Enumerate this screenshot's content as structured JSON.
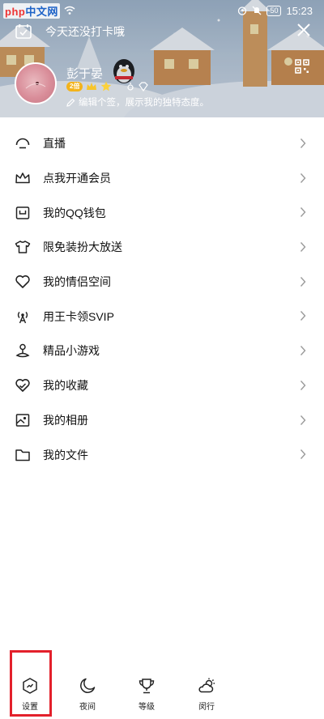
{
  "status_bar": {
    "watermark_red": "php",
    "watermark_blue": "中文网",
    "battery": "50",
    "time": "15:23"
  },
  "header": {
    "checkin_text": "今天还没打卡哦",
    "nickname": "彭于晏",
    "level_badge": "2倍",
    "signature": "编辑个签，展示我的独特态度。"
  },
  "menu": {
    "items": [
      {
        "label": "直播",
        "icon": "live-icon"
      },
      {
        "label": "点我开通会员",
        "icon": "crown-icon"
      },
      {
        "label": "我的QQ钱包",
        "icon": "wallet-icon"
      },
      {
        "label": "限免装扮大放送",
        "icon": "tshirt-icon"
      },
      {
        "label": "我的情侣空间",
        "icon": "heart-icon"
      },
      {
        "label": "用王卡领SVIP",
        "icon": "signal-tower-icon"
      },
      {
        "label": "精品小游戏",
        "icon": "joystick-icon"
      },
      {
        "label": "我的收藏",
        "icon": "heart-check-icon"
      },
      {
        "label": "我的相册",
        "icon": "photo-icon"
      },
      {
        "label": "我的文件",
        "icon": "folder-icon"
      }
    ]
  },
  "bottom_bar": {
    "tabs": [
      {
        "label": "设置",
        "icon": "shield-settings-icon"
      },
      {
        "label": "夜间",
        "icon": "moon-icon"
      },
      {
        "label": "等级",
        "icon": "trophy-icon"
      },
      {
        "label": "闵行",
        "icon": "weather-icon"
      }
    ]
  },
  "colors": {
    "highlight": "#e3202b",
    "text": "#111111",
    "icon_stroke": "#222222",
    "chevron": "#9a9a9a"
  }
}
